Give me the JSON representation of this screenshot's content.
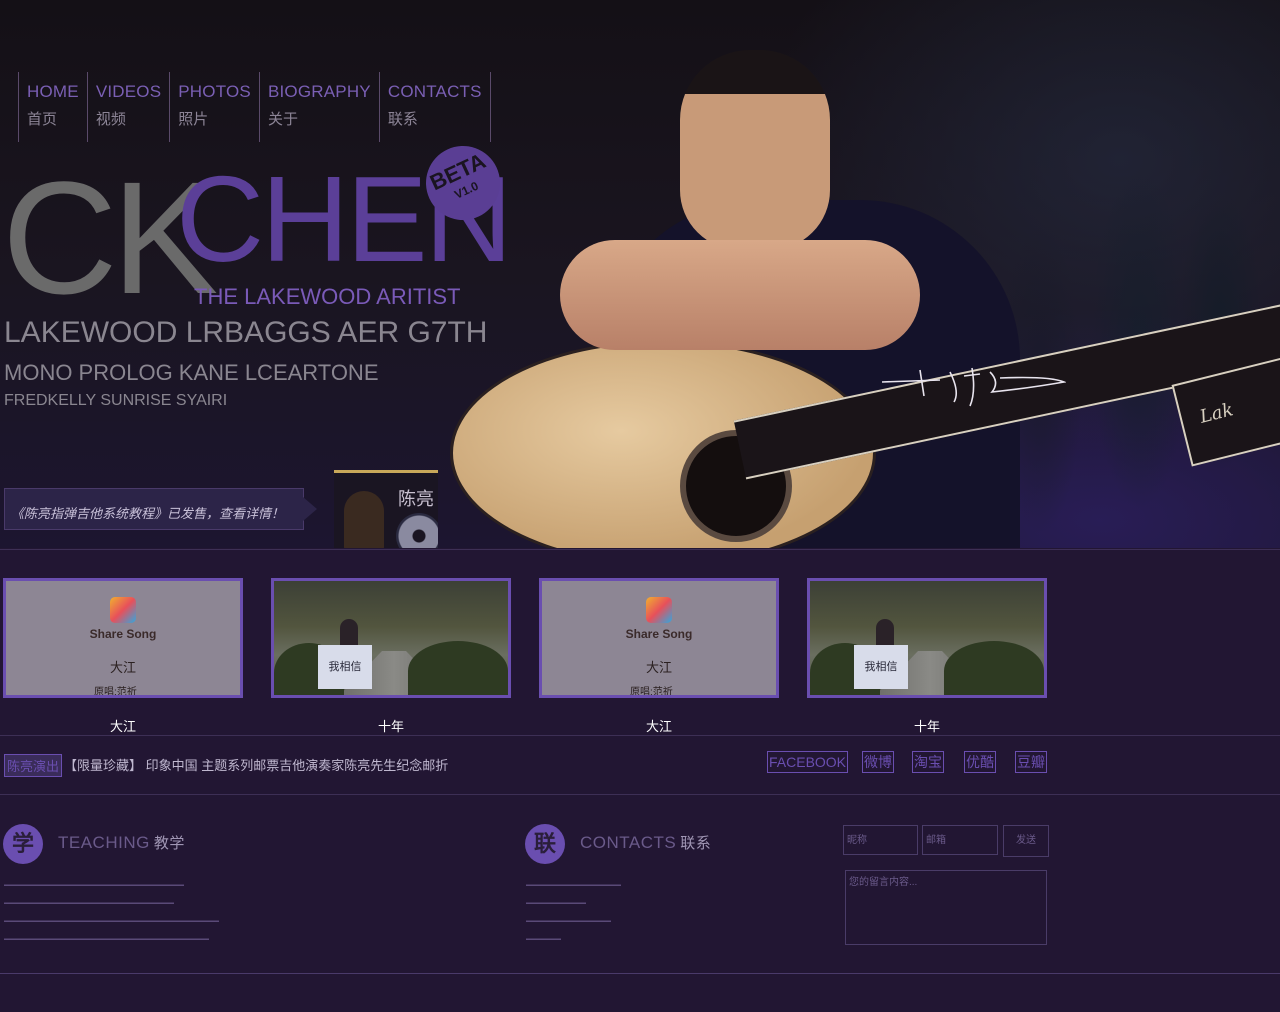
{
  "nav": [
    {
      "en": "HOME",
      "cn": "首页"
    },
    {
      "en": "VIDEOS",
      "cn": "视频"
    },
    {
      "en": "PHOTOS",
      "cn": "照片"
    },
    {
      "en": "BIOGRAPHY",
      "cn": "关于"
    },
    {
      "en": "CONTACTS",
      "cn": "联系"
    }
  ],
  "hero": {
    "logo_ck": "CK",
    "logo_chen": "CHEN",
    "tagline": "THE LAKEWOOD ARITIST",
    "beta": "BETA",
    "beta_version": "V1.0",
    "line1": "LAKEWOOD LRBAGGS AER G7TH",
    "line2": "MONO PROLOG KANE LCEARTONE",
    "line3": "FREDKELLY SUNRISE SYAIRI",
    "banner": "《陈亮指弹吉他系统教程》已发售，查看详情！",
    "album_title": "陈亮",
    "headstock": "Lak"
  },
  "videos": [
    {
      "type": "share",
      "brand": "Share Song",
      "song": "大江",
      "original": "原唱:范祈",
      "caption": "大江"
    },
    {
      "type": "photo",
      "sign": "我相信",
      "caption": "十年"
    },
    {
      "type": "share",
      "brand": "Share Song",
      "song": "大江",
      "original": "原唱:范祈",
      "caption": "大江"
    },
    {
      "type": "photo",
      "sign": "我相信",
      "caption": "十年"
    }
  ],
  "news": {
    "tag": "陈亮演出",
    "text": "【限量珍藏】 印象中国 主题系列邮票吉他演奏家陈亮先生纪念邮折"
  },
  "social": [
    "FACEBOOK",
    "微博",
    "淘宝",
    "优酷",
    "豆瓣"
  ],
  "footer": {
    "teaching": {
      "char": "学",
      "en": "TEACHING",
      "cn": "教学"
    },
    "contacts": {
      "char": "联",
      "en": "CONTACTS",
      "cn": "联系"
    },
    "form": {
      "name_placeholder": "昵称",
      "email_placeholder": "邮箱",
      "send": "发送",
      "message_placeholder": "您的留言内容..."
    }
  },
  "colors": {
    "accent": "#6a4eb0",
    "background": "#221633"
  }
}
